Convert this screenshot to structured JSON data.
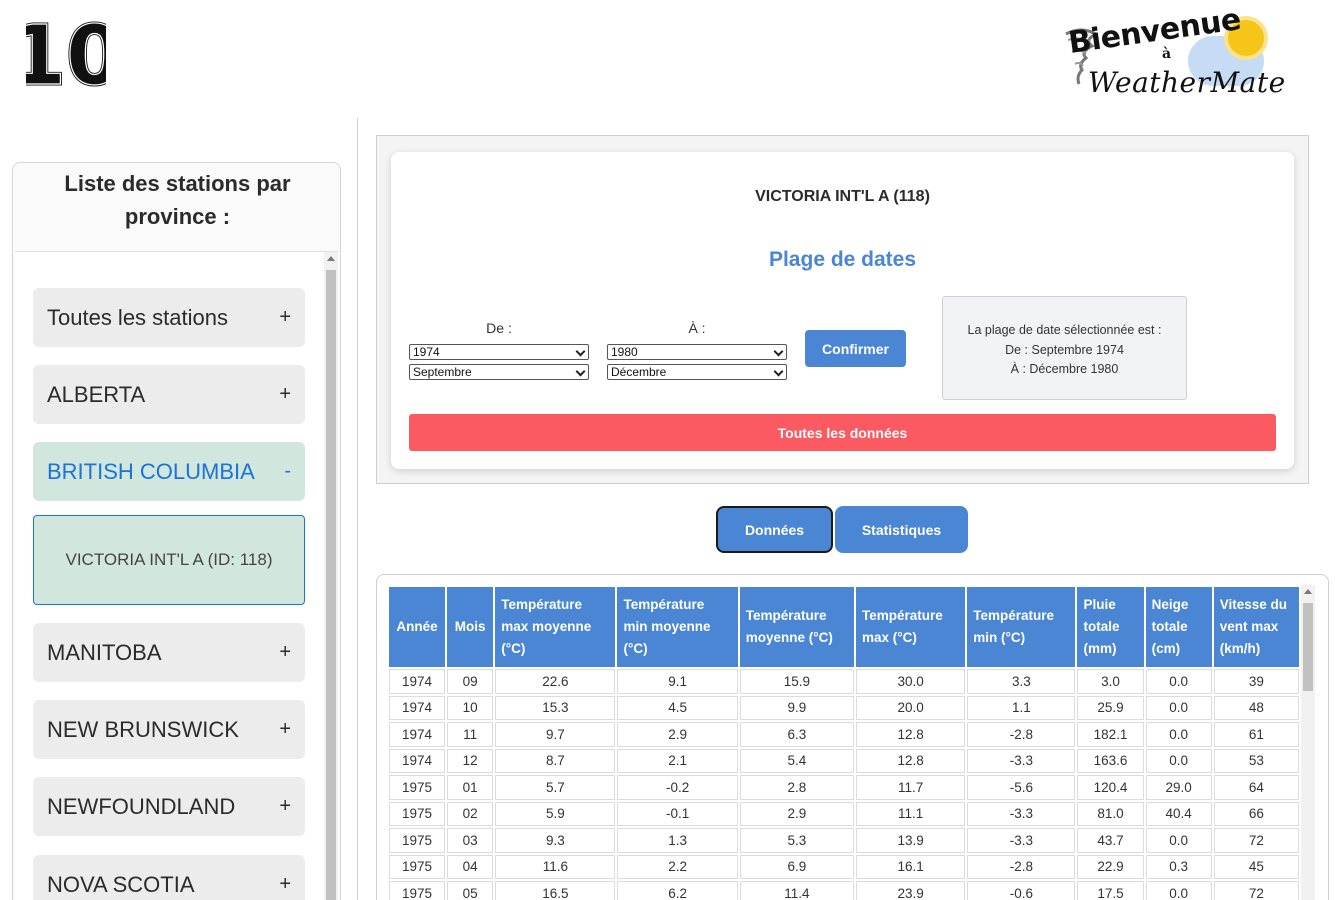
{
  "header": {
    "team_number": "10",
    "brand_line1": "Bienvenue",
    "brand_line2": "à",
    "brand_line3": "WeatherMate"
  },
  "sidebar": {
    "title": "Liste des stations par province :",
    "provinces": [
      {
        "label": "Toutes les stations",
        "sign": "+"
      },
      {
        "label": "ALBERTA",
        "sign": "+"
      },
      {
        "label": "BRITISH COLUMBIA",
        "sign": "-"
      },
      {
        "label": "MANITOBA",
        "sign": "+"
      },
      {
        "label": "NEW BRUNSWICK",
        "sign": "+"
      },
      {
        "label": "NEWFOUNDLAND",
        "sign": "+"
      },
      {
        "label": "NOVA SCOTIA",
        "sign": "+"
      }
    ],
    "selected_station": "VICTORIA INT'L A (ID: 118)"
  },
  "date_panel": {
    "station_title": "VICTORIA INT'L A (118)",
    "range_title": "Plage de dates",
    "from_label": "De :",
    "to_label": "À :",
    "from_year": "1974",
    "from_month": "Septembre",
    "to_year": "1980",
    "to_month": "Décembre",
    "confirm_label": "Confirmer",
    "info_line1": "La plage de date sélectionnée est :",
    "info_line2": "De : Septembre 1974",
    "info_line3": "À : Décembre 1980",
    "all_data_label": "Toutes les données"
  },
  "tabs": {
    "data_label": "Données",
    "stats_label": "Statistiques"
  },
  "table": {
    "headers": [
      "Année",
      "Mois",
      "Température max moyenne (°C)",
      "Température min moyenne (°C)",
      "Température moyenne (°C)",
      "Température max (°C)",
      "Température min (°C)",
      "Pluie totale (mm)",
      "Neige totale (cm)",
      "Vitesse du vent max (km/h)"
    ],
    "rows": [
      [
        "1974",
        "09",
        "22.6",
        "9.1",
        "15.9",
        "30.0",
        "3.3",
        "3.0",
        "0.0",
        "39"
      ],
      [
        "1974",
        "10",
        "15.3",
        "4.5",
        "9.9",
        "20.0",
        "1.1",
        "25.9",
        "0.0",
        "48"
      ],
      [
        "1974",
        "11",
        "9.7",
        "2.9",
        "6.3",
        "12.8",
        "-2.8",
        "182.1",
        "0.0",
        "61"
      ],
      [
        "1974",
        "12",
        "8.7",
        "2.1",
        "5.4",
        "12.8",
        "-3.3",
        "163.6",
        "0.0",
        "53"
      ],
      [
        "1975",
        "01",
        "5.7",
        "-0.2",
        "2.8",
        "11.7",
        "-5.6",
        "120.4",
        "29.0",
        "64"
      ],
      [
        "1975",
        "02",
        "5.9",
        "-0.1",
        "2.9",
        "11.1",
        "-3.3",
        "81.0",
        "40.4",
        "66"
      ],
      [
        "1975",
        "03",
        "9.3",
        "1.3",
        "5.3",
        "13.9",
        "-3.3",
        "43.7",
        "0.0",
        "72"
      ],
      [
        "1975",
        "04",
        "11.6",
        "2.2",
        "6.9",
        "16.1",
        "-2.8",
        "22.9",
        "0.3",
        "45"
      ],
      [
        "1975",
        "05",
        "16.5",
        "6.2",
        "11.4",
        "23.9",
        "-0.6",
        "17.5",
        "0.0",
        "72"
      ]
    ]
  },
  "colors": {
    "accent": "#4a86d4",
    "danger": "#fb5a63",
    "active_bg": "#d1e7dd",
    "active_text": "#1a73d9"
  }
}
